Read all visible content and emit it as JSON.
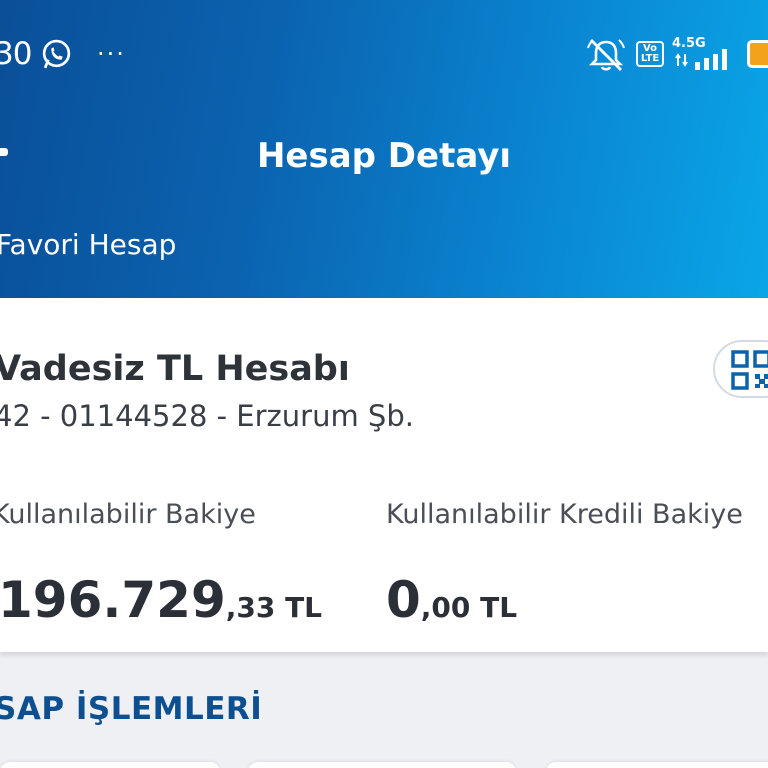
{
  "status_bar": {
    "time": "30",
    "more": "···",
    "volte": "Vo LTE",
    "network": "4.5G"
  },
  "header": {
    "title": "Hesap Detayı",
    "favorite": "Favori Hesap"
  },
  "account": {
    "name": "Vadesiz TL Hesabı",
    "number": "42 - 01144528 - Erzurum Şb.",
    "available_label": "Kullanılabilir Bakiye",
    "available_int": "196.729",
    "available_dec": ",33 TL",
    "credit_label": "Kullanılabilir Kredili Bakiye",
    "credit_int": "0",
    "credit_dec": ",00 TL"
  },
  "section": {
    "title": "SAP İŞLEMLERİ"
  },
  "icons": {
    "whatsapp": "whatsapp-icon",
    "mute": "mute-icon",
    "signal": "signal-icon",
    "battery": "battery-icon",
    "qr": "qr-code-icon"
  },
  "colors": {
    "header_start": "#0a4f98",
    "header_end": "#0aa6e6",
    "section_title": "#0d4f90",
    "battery": "#f2a31b"
  }
}
